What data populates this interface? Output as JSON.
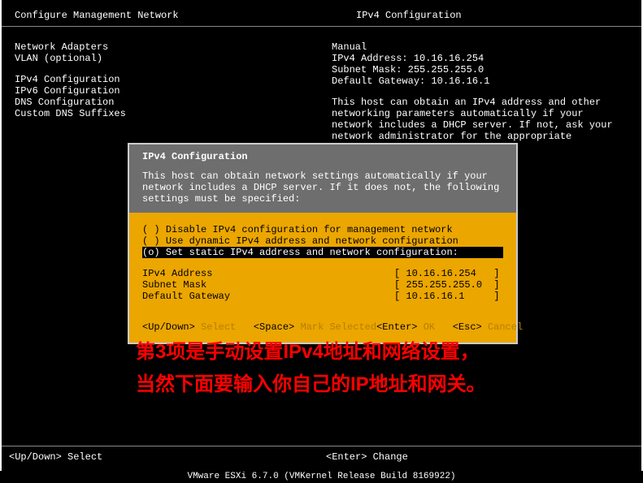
{
  "header": {
    "left": "Configure Management Network",
    "right": "IPv4 Configuration"
  },
  "menu": {
    "items": [
      "Network Adapters",
      "VLAN (optional)",
      "",
      "IPv4 Configuration",
      "IPv6 Configuration",
      "DNS Configuration",
      "Custom DNS Suffixes"
    ]
  },
  "info": {
    "mode": "Manual",
    "blank": "",
    "addr_label": "IPv4 Address: 10.16.16.254",
    "mask_label": "Subnet Mask: 255.255.255.0",
    "gw_label": "Default Gateway: 10.16.16.1",
    "para": "This host can obtain an IPv4 address and other networking parameters automatically if your network includes a DHCP server. If not, ask your network administrator for the appropriate settings."
  },
  "dialog": {
    "title": "IPv4 Configuration",
    "desc": "This host can obtain network settings automatically if your network includes a DHCP server. If it does not, the following settings must be specified:",
    "options": [
      {
        "mark": "( )",
        "text": "Disable IPv4 configuration for management network",
        "selected": false
      },
      {
        "mark": "( )",
        "text": "Use dynamic IPv4 address and network configuration",
        "selected": false
      },
      {
        "mark": "(o)",
        "text": "Set static IPv4 address and network configuration:",
        "selected": true
      }
    ],
    "fields": [
      {
        "label": "IPv4 Address",
        "value": "[ 10.16.16.254   ]"
      },
      {
        "label": "Subnet Mask",
        "value": "[ 255.255.255.0  ]"
      },
      {
        "label": "Default Gateway",
        "value": "[ 10.16.16.1     ]"
      }
    ],
    "hints": {
      "left1": "<Up/Down>",
      "left1b": "Select",
      "left2": "<Space>",
      "left2b": "Mark Selected",
      "right1": "<Enter>",
      "right1b": "OK",
      "right2": "<Esc>",
      "right2b": "Cancel"
    }
  },
  "annotation": {
    "line1": "第3项是手动设置IPv4地址和网络设置，",
    "line2": "当然下面要输入你自己的IP地址和网关。"
  },
  "bottom": {
    "left": "<Up/Down> Select",
    "right": "<Enter> Change"
  },
  "status": "VMware ESXi 6.7.0 (VMKernel Release Build 8169922)"
}
